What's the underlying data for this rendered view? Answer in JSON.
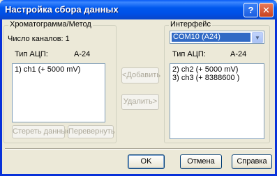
{
  "window": {
    "title": "Настройка сбора данных",
    "help_label": "?",
    "close_label": "✕"
  },
  "left_group": {
    "legend": "Хроматограмма/Метод",
    "channel_count": "Число каналов: 1",
    "adc_label": "Тип АЦП:",
    "adc_value": "A-24",
    "channels": [
      "1) ch1 (+ 5000 mV)"
    ],
    "clear_label": "Стереть данные",
    "flip_label": "Перевернуть"
  },
  "middle": {
    "add_label": "<Добавить",
    "remove_label": "Удалить>"
  },
  "right_group": {
    "legend": "Интерфейс",
    "interface_value": "COM10 (A24)",
    "adc_label": "Тип АЦП:",
    "adc_value": "A-24",
    "channels": [
      "2) ch2 (+ 5000 mV)",
      "3) ch3 (+ 8388600 )"
    ]
  },
  "footer": {
    "ok_label": "OK",
    "cancel_label": "Отмена",
    "help_label": "Справка"
  },
  "colors": {
    "titlebar": "#0054e3",
    "dialog_bg": "#ece9d8",
    "selection": "#316ac5"
  }
}
